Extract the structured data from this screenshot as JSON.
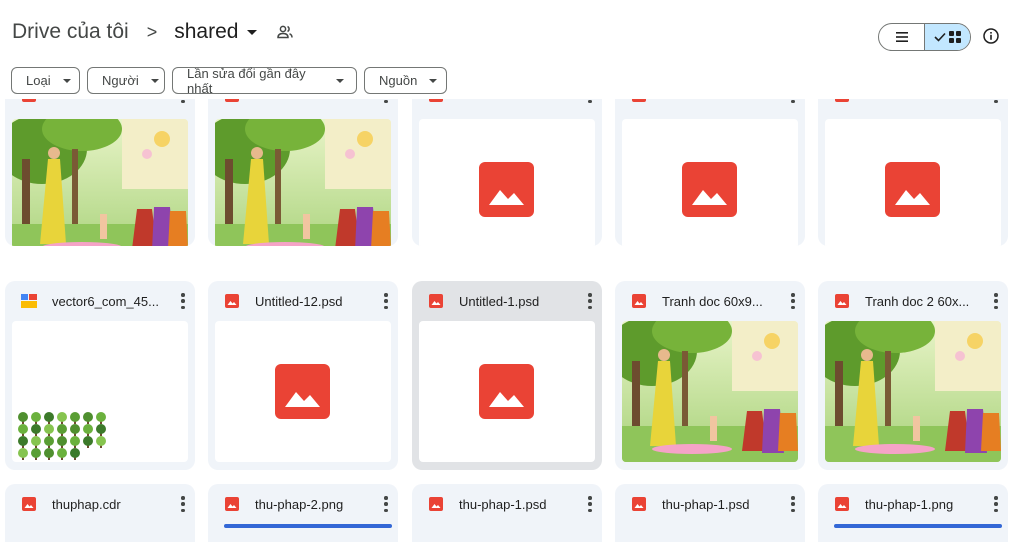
{
  "breadcrumb": {
    "root": "Drive của tôi",
    "separator": ">",
    "current": "shared"
  },
  "filters": [
    {
      "label": "Loại"
    },
    {
      "label": "Người"
    },
    {
      "label": "Lần sửa đổi gần đây nhất"
    },
    {
      "label": "Nguồn"
    }
  ],
  "colors": {
    "accent": "#c2e7ff",
    "image_icon": "#ea4335",
    "selected_card": "#e1e3e6",
    "card_bg": "#f0f4f9"
  },
  "icons": {
    "view_list": "list-icon",
    "view_grid": "grid-icon",
    "check": "check-icon",
    "info": "info-icon",
    "shared_people": "people-icon"
  },
  "rows": [
    {
      "files": [
        {
          "name": "",
          "type": "image",
          "thumb": "painting"
        },
        {
          "name": "",
          "type": "image",
          "thumb": "painting"
        },
        {
          "name": "",
          "type": "image",
          "thumb": "placeholder"
        },
        {
          "name": "",
          "type": "image",
          "thumb": "placeholder"
        },
        {
          "name": "",
          "type": "image",
          "thumb": "placeholder"
        }
      ]
    },
    {
      "files": [
        {
          "name": "vector6_com_45...",
          "type": "multicolor",
          "thumb": "trees"
        },
        {
          "name": "Untitled-12.psd",
          "type": "image",
          "thumb": "placeholder"
        },
        {
          "name": "Untitled-1.psd",
          "type": "image",
          "thumb": "placeholder",
          "selected": true
        },
        {
          "name": "Tranh doc 60x9...",
          "type": "image",
          "thumb": "painting"
        },
        {
          "name": "Tranh doc 2 60x...",
          "type": "image",
          "thumb": "painting"
        }
      ]
    },
    {
      "files": [
        {
          "name": "thuphap.cdr",
          "type": "image",
          "thumb": "none"
        },
        {
          "name": "thu-phap-2.png",
          "type": "image",
          "thumb": "bar"
        },
        {
          "name": "thu-phap-1.psd",
          "type": "image",
          "thumb": "none"
        },
        {
          "name": "thu-phap-1.psd",
          "type": "image",
          "thumb": "none"
        },
        {
          "name": "thu-phap-1.png",
          "type": "image",
          "thumb": "bar"
        }
      ]
    }
  ]
}
